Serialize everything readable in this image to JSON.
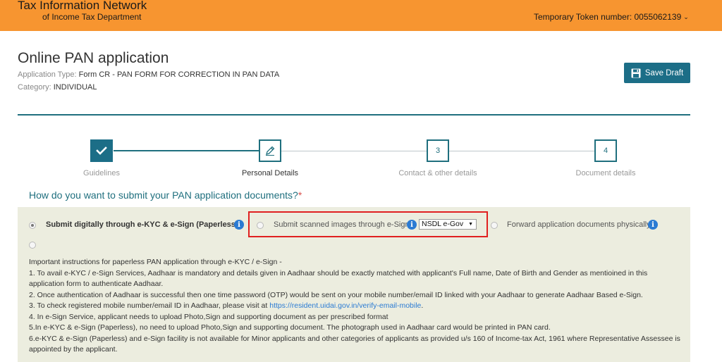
{
  "header": {
    "brand_line1": "Tax Information Network",
    "brand_line2": "of Income Tax Department",
    "token_label": "Temporary Token number: 0055062139",
    "token_caret": "⌄"
  },
  "page": {
    "title": "Online PAN application",
    "app_type_key": "Application Type: ",
    "app_type_value": "Form CR - PAN FORM FOR CORRECTION IN PAN DATA",
    "category_key": "Category: ",
    "category_value": "INDIVIDUAL",
    "save_label": "Save Draft"
  },
  "stepper": {
    "steps": [
      {
        "label": "Guidelines",
        "marker": "",
        "state": "done"
      },
      {
        "label": "Personal Details",
        "marker": "",
        "state": "active"
      },
      {
        "label": "Contact & other details",
        "marker": "3",
        "state": "pending"
      },
      {
        "label": "Document details",
        "marker": "4",
        "state": "pending"
      }
    ]
  },
  "question": {
    "text": "How do you want to submit your PAN application documents?",
    "required_mark": "*"
  },
  "options": {
    "opt1": "Submit digitally through e-KYC & e-Sign (Paperless)",
    "opt2": "Submit scanned images through e-Sign",
    "opt2_select_value": "NSDL e-Gov",
    "opt3": "Forward application documents physically",
    "info_glyph": "i"
  },
  "instructions": {
    "heading": "Important instructions for paperless PAN application through e-KYC / e-Sign -",
    "line1": "1. To avail e-KYC / e-Sign Services, Aadhaar is mandatory and details given in Aadhaar should be exactly matched with applicant's Full name, Date of Birth and Gender as mentioined in this application form to authenticate Aadhaar.",
    "line2": "2. Once authentication of Aadhaar is successful then one time password (OTP) would be sent on your mobile number/email ID linked with your Aadhaar to generate Aadhaar Based e-Sign.",
    "line3_prefix": "3. To check registered mobile number/email ID in Aadhaar, please visit at ",
    "line3_link": "https://resident.uidai.gov.in/verify-email-mobile",
    "line3_suffix": ".",
    "line4": "4. In e-Sign Service, applicant needs to upload Photo,Sign and supporting document as per prescribed format",
    "line5": "5.In e-KYC & e-Sign (Paperless), no need to upload Photo,Sign and supporting document. The photograph used in Aadhaar card would be printed in PAN card.",
    "line6": "6.e-KYC & e-Sign (Paperless) and e-Sign facility is not available for Minor applicants and other categories of applicants as provided u/s 160 of Income-tax Act, 1961 where Representative Assessee is appointed by the applicant."
  },
  "colors": {
    "header_bg": "#f79530",
    "accent": "#1f6f7e",
    "button": "#1c6e87",
    "panel_bg": "#eceddf",
    "highlight_box": "#e02020",
    "info_icon": "#2b7bd3"
  }
}
